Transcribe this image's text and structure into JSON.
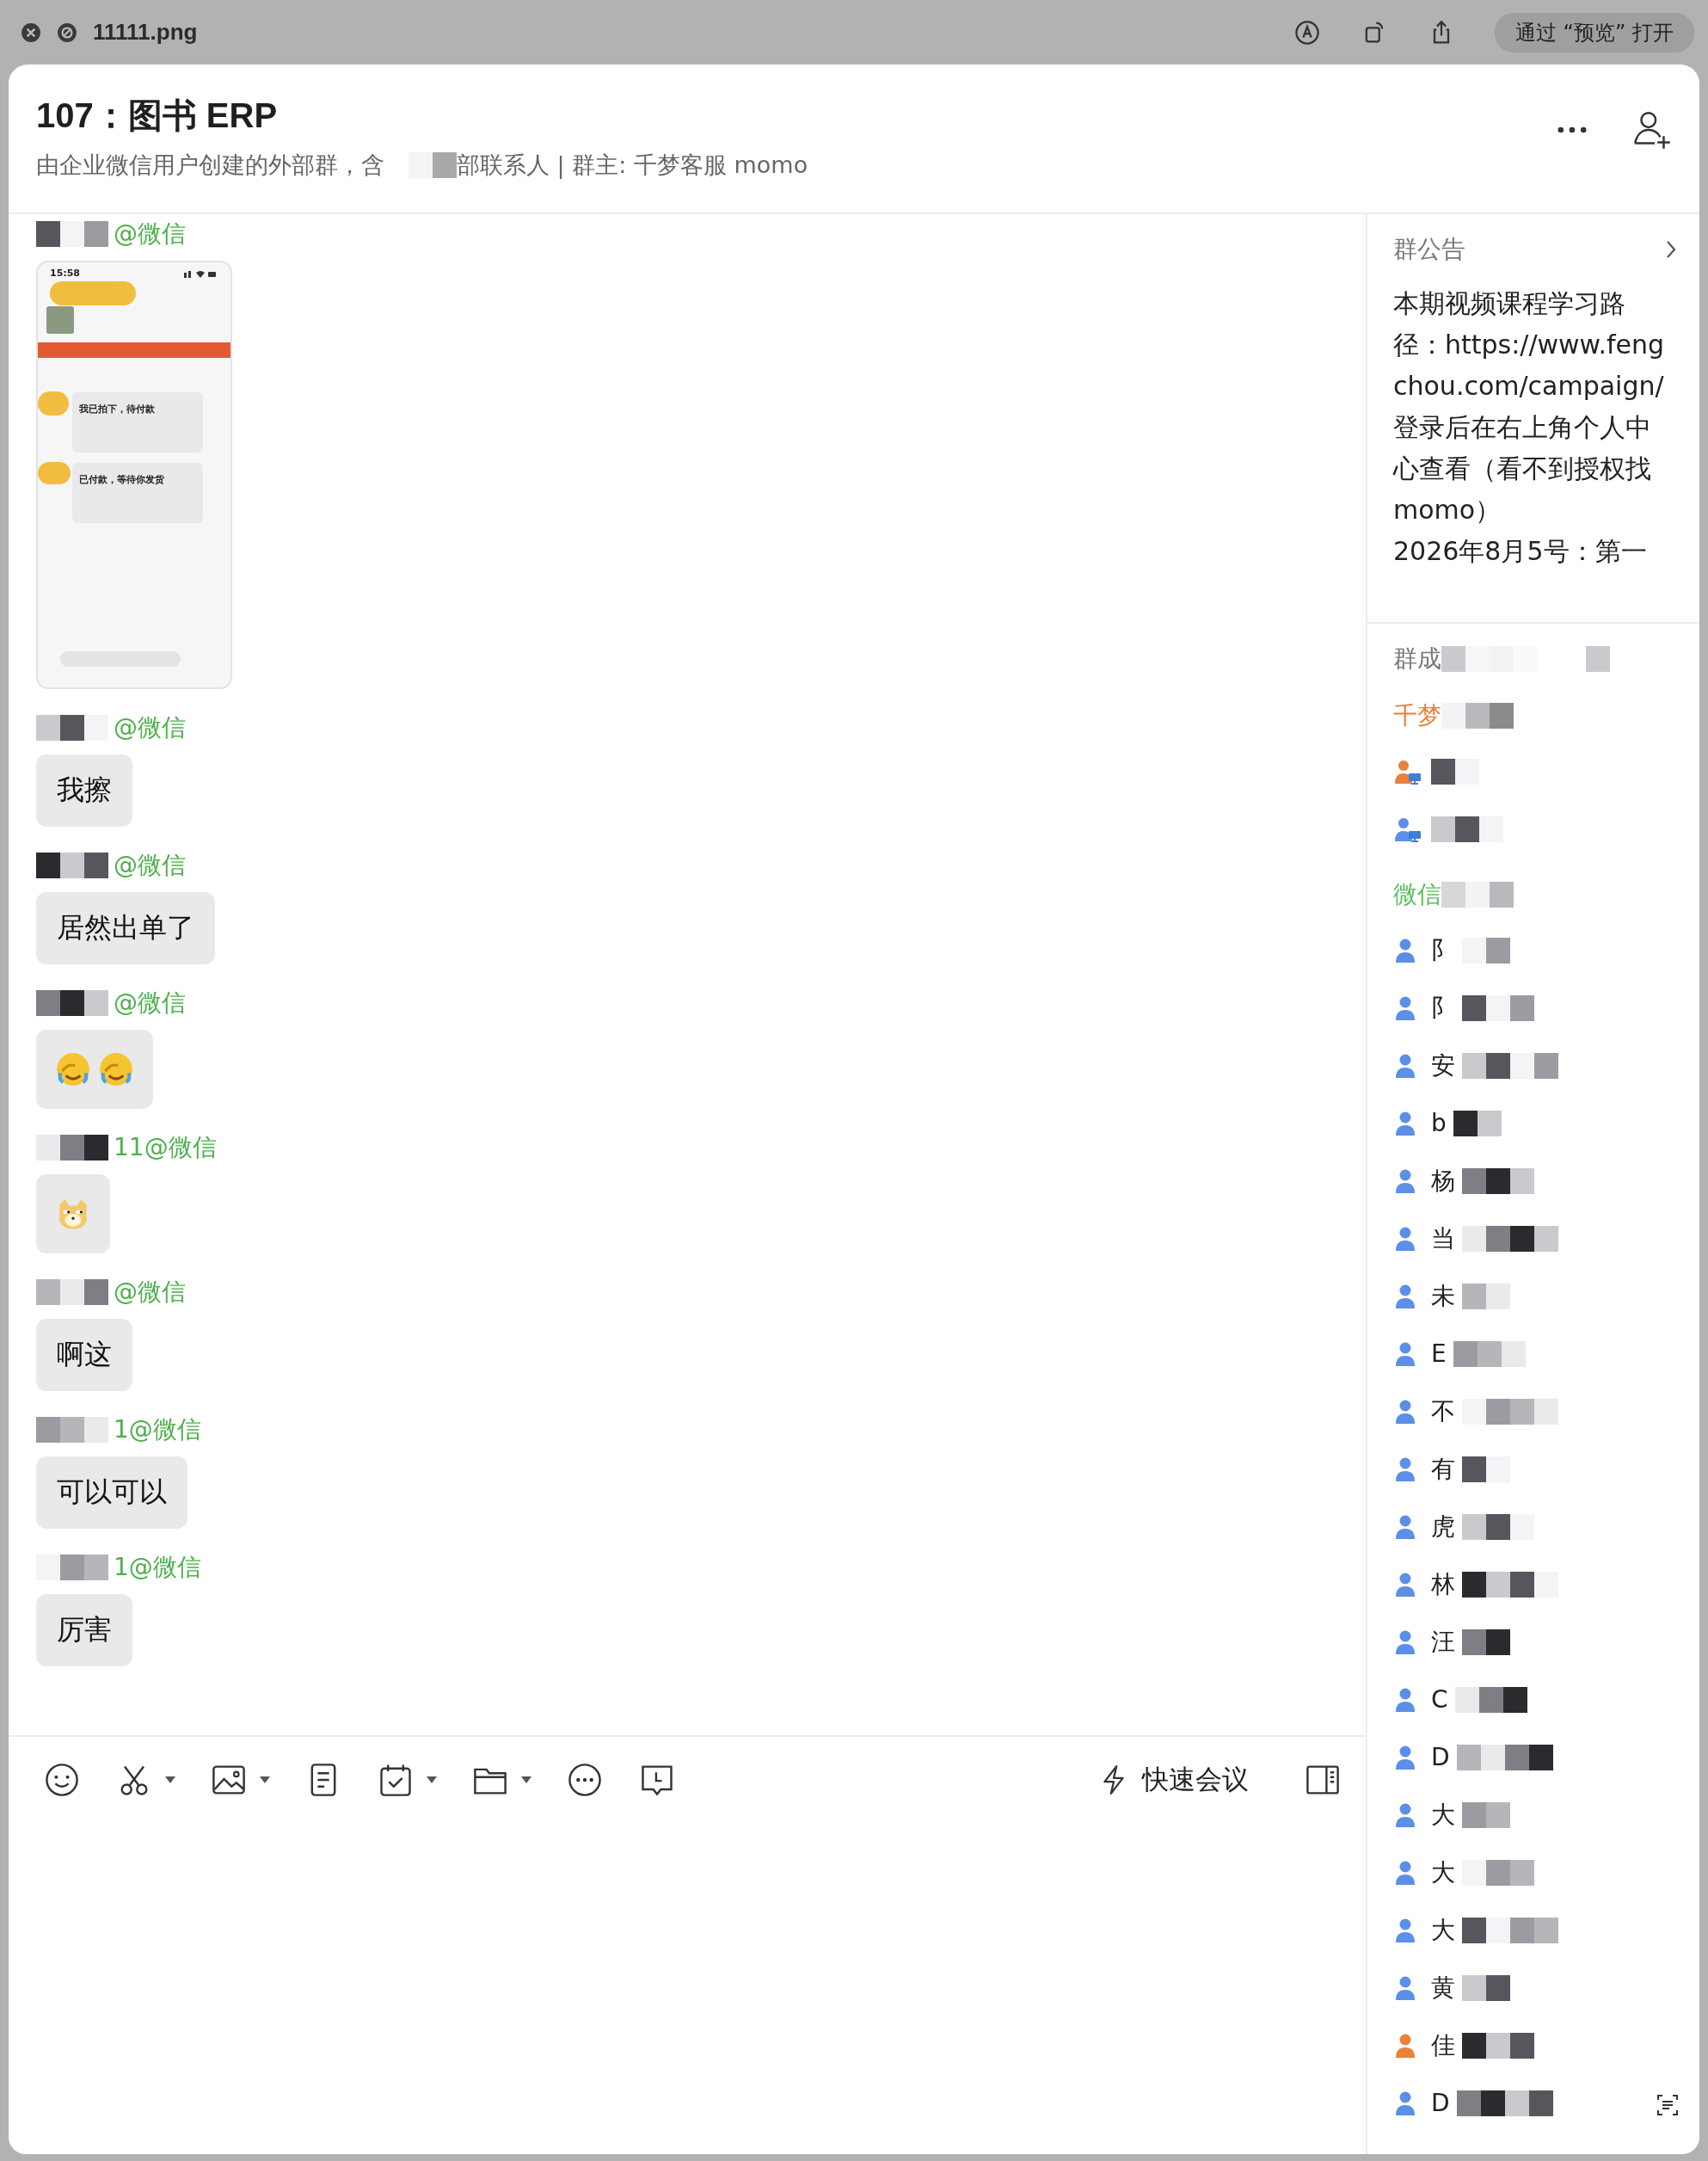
{
  "viewer": {
    "file_name": "11111.png",
    "open_button": "通过 “预览” 打开"
  },
  "chat": {
    "title": "107：图书 ERP",
    "subtitle_before": "由企业微信用户创建的外部群，含",
    "subtitle_after": "部联系人 | 群主: 千梦客服 momo"
  },
  "messages": [
    {
      "kind": "image",
      "sender": "@微信",
      "screenshot": {
        "time": "15:58",
        "cards": [
          "我已拍下，待付款",
          "已付款，等待你发货"
        ]
      }
    },
    {
      "kind": "text",
      "sender": "@微信",
      "text": "我擦"
    },
    {
      "kind": "text",
      "sender": "@微信",
      "text": "居然出单了"
    },
    {
      "kind": "sticker",
      "sender": "@微信",
      "stickers": [
        {
          "kind": "facepalm"
        },
        {
          "kind": "facepalm"
        }
      ]
    },
    {
      "kind": "sticker",
      "sender": "11@微信",
      "stickers": [
        {
          "kind": "doge"
        }
      ]
    },
    {
      "kind": "text",
      "sender": "@微信",
      "text": "啊这"
    },
    {
      "kind": "text",
      "sender": "1@微信",
      "text": "可以可以"
    },
    {
      "kind": "text",
      "sender": "1@微信",
      "text": "厉害"
    }
  ],
  "toolbar": {
    "meeting_button": "快速会议"
  },
  "sidebar": {
    "notice_title": "群公告",
    "notice_paragraphs": [
      "本期视频课程学习路径：https://www.fengchou.com/campaign/",
      "登录后在右上角个人中心查看（看不到授权找 momo）",
      "2026年8月5号：第一"
    ],
    "members_title": "群成",
    "groups": [
      {
        "name": "千梦",
        "color": "#e8813a",
        "members": [
          {
            "kind": "staff",
            "color": "#e8813a"
          },
          {
            "kind": "staff",
            "color": "#5b8fe8"
          }
        ]
      },
      {
        "name": "微信",
        "color": "#5bbf5b",
        "members": [
          {
            "kind": "user",
            "name": "阝",
            "color": "#5b8fe8"
          },
          {
            "kind": "user",
            "name": "阝",
            "color": "#5b8fe8"
          },
          {
            "kind": "user",
            "name": "安",
            "color": "#5b8fe8"
          },
          {
            "kind": "user",
            "name": "b",
            "color": "#5b8fe8"
          },
          {
            "kind": "user",
            "name": "杨",
            "color": "#5b8fe8"
          },
          {
            "kind": "user",
            "name": "当",
            "color": "#5b8fe8"
          },
          {
            "kind": "user",
            "name": "未",
            "color": "#5b8fe8"
          },
          {
            "kind": "user",
            "name": "E",
            "color": "#5b8fe8"
          },
          {
            "kind": "user",
            "name": "不",
            "color": "#5b8fe8"
          },
          {
            "kind": "user",
            "name": "有",
            "color": "#5b8fe8"
          },
          {
            "kind": "user",
            "name": "虎",
            "color": "#5b8fe8"
          },
          {
            "kind": "user",
            "name": "林",
            "color": "#5b8fe8"
          },
          {
            "kind": "user",
            "name": "汪",
            "color": "#5b8fe8"
          },
          {
            "kind": "user",
            "name": "C",
            "color": "#5b8fe8"
          },
          {
            "kind": "user",
            "name": "D",
            "color": "#5b8fe8"
          },
          {
            "kind": "user",
            "name": "大",
            "color": "#5b8fe8"
          },
          {
            "kind": "user",
            "name": "大",
            "color": "#5b8fe8"
          },
          {
            "kind": "user",
            "name": "大",
            "color": "#5b8fe8"
          },
          {
            "kind": "user",
            "name": "黄",
            "color": "#5b8fe8"
          },
          {
            "kind": "user",
            "name": "佳",
            "color": "#e8813a"
          },
          {
            "kind": "user",
            "name": "D",
            "color": "#5b8fe8"
          }
        ]
      }
    ]
  }
}
